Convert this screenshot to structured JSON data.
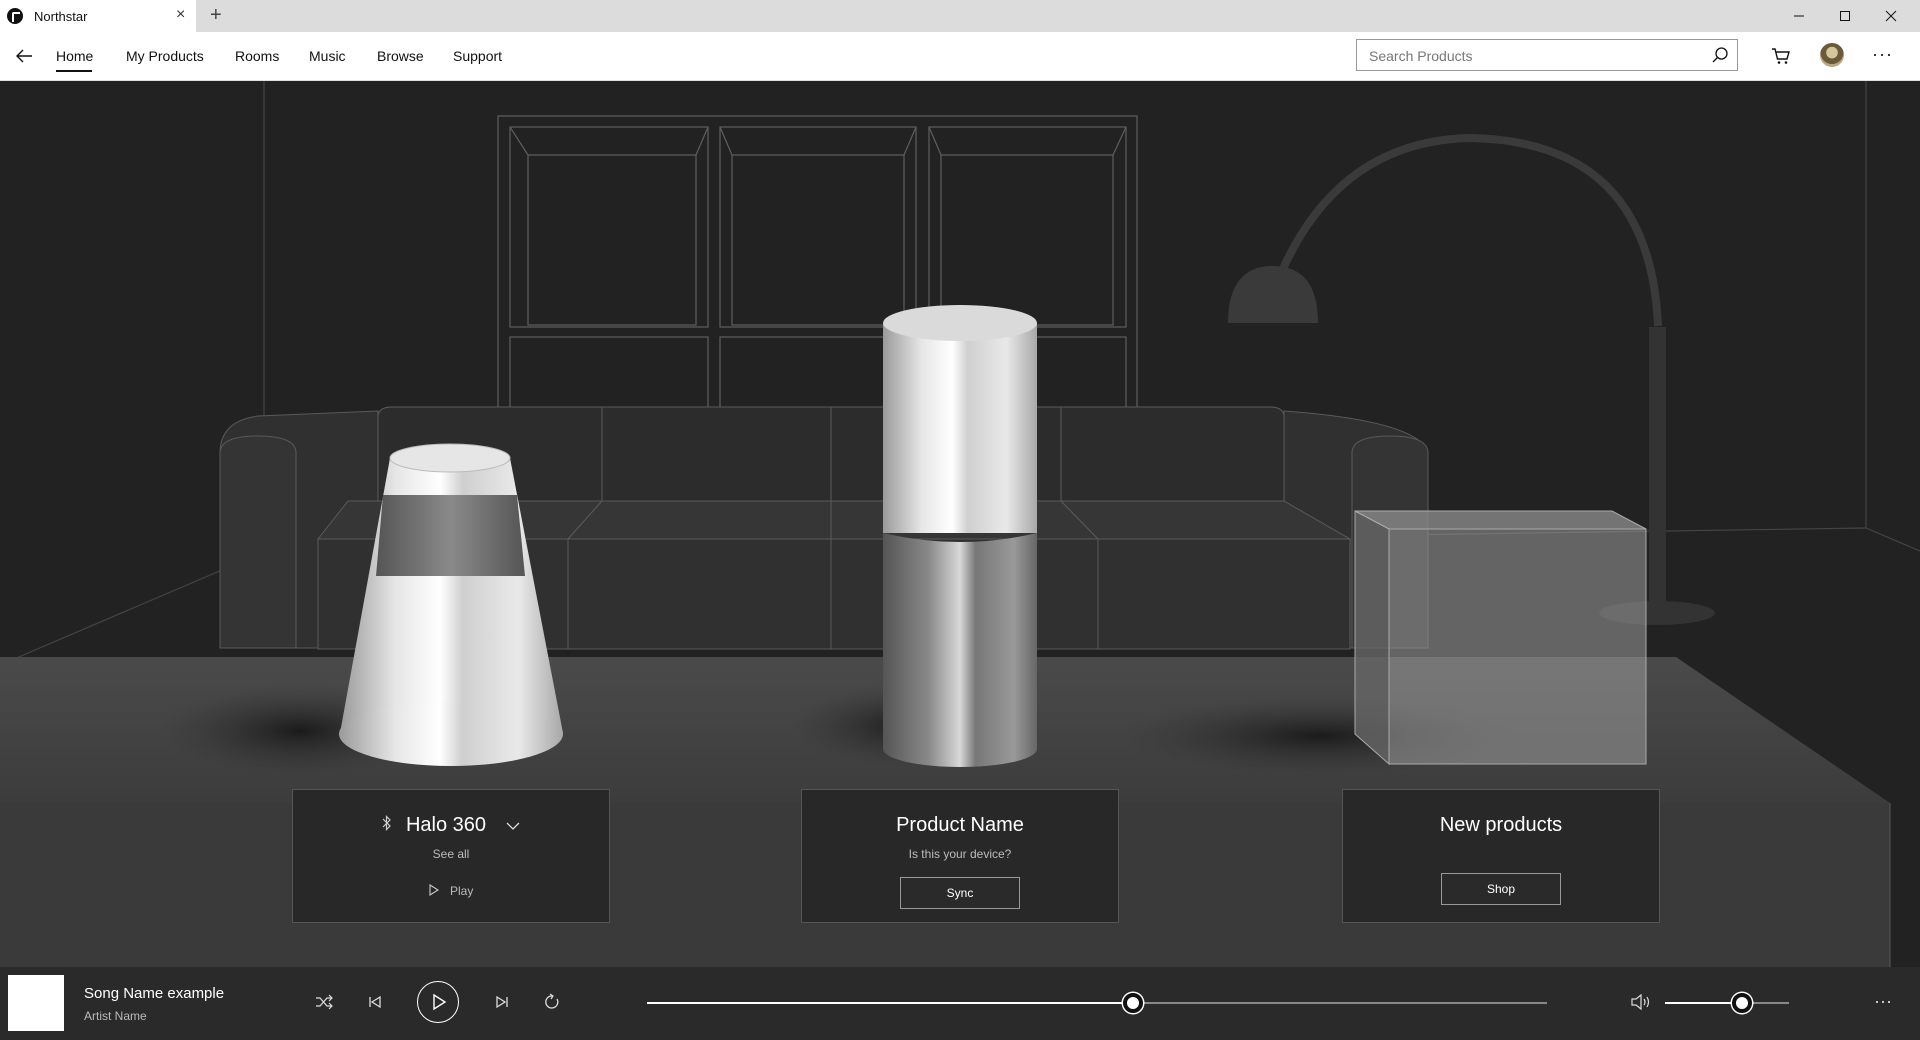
{
  "window": {
    "tab_title": "Northstar",
    "close_glyph": "×",
    "new_tab_glyph": "+"
  },
  "nav": {
    "items": [
      "Home",
      "My Products",
      "Rooms",
      "Music",
      "Browse",
      "Support"
    ],
    "active": "Home",
    "search_placeholder": "Search Products"
  },
  "cards": [
    {
      "title": "Halo 360",
      "subtitle": "See all",
      "action": "Play",
      "icon": "bluetooth-icon"
    },
    {
      "title": "Product Name",
      "subtitle": "Is this your device?",
      "action": "Sync"
    },
    {
      "title": "New products",
      "action": "Shop"
    }
  ],
  "player": {
    "song": "Song Name example",
    "artist": "Artist Name",
    "progress": 0.54,
    "volume": 0.62
  },
  "colors": {
    "accent": "#ffffff",
    "scene_bg": "#1f1f1f",
    "player_bg": "#2a2a2a"
  }
}
